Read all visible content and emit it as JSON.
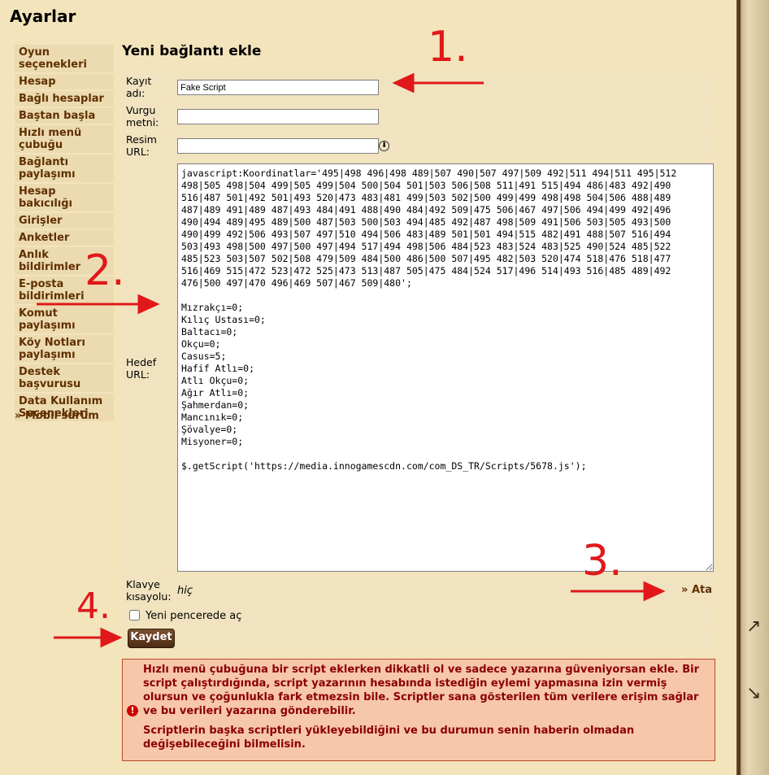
{
  "page_title": "Ayarlar",
  "sidebar": {
    "items": [
      {
        "label": "Oyun seçenekleri"
      },
      {
        "label": "Hesap"
      },
      {
        "label": "Bağlı hesaplar"
      },
      {
        "label": "Baştan başla"
      },
      {
        "label": "Hızlı menü çubuğu"
      },
      {
        "label": "Bağlantı paylaşımı"
      },
      {
        "label": "Hesap bakıcılığı"
      },
      {
        "label": "Girişler"
      },
      {
        "label": "Anketler"
      },
      {
        "label": "Anlık bildirimler"
      },
      {
        "label": "E-posta bildirimleri"
      },
      {
        "label": "Komut paylaşımı"
      },
      {
        "label": "Köy Notları paylaşımı"
      },
      {
        "label": "Destek başvurusu"
      },
      {
        "label": "Data Kullanım Seçenekleri"
      }
    ],
    "mobile_link": "» Mobil sürüm"
  },
  "form": {
    "title": "Yeni bağlantı ekle",
    "name_label": "Kayıt adı:",
    "name_value": "Fake Script",
    "highlight_label": "Vurgu metni:",
    "highlight_value": "",
    "image_label": "Resim URL:",
    "image_value": "",
    "target_label": "Hedef URL:",
    "target_value": "javascript:Koordinatlar='495|498 496|498 489|507 490|507 497|509 492|511 494|511 495|512 498|505 498|504 499|505 499|504 500|504 501|503 506|508 511|491 515|494 486|483 492|490 516|487 501|492 501|493 520|473 483|481 499|503 502|500 499|499 498|498 504|506 488|489 487|489 491|489 487|493 484|491 488|490 484|492 509|475 506|467 497|506 494|499 492|496 490|494 489|495 489|500 487|503 500|503 494|485 492|487 498|509 491|506 503|505 493|500 490|499 492|506 493|507 497|510 494|506 483|489 501|501 494|515 482|491 488|507 516|494 503|493 498|500 497|500 497|494 517|494 498|506 484|523 483|524 483|525 490|524 485|522 485|523 503|507 502|508 479|509 484|500 486|500 507|495 482|503 520|474 518|476 518|477 516|469 515|472 523|472 525|473 513|487 505|475 484|524 517|496 514|493 516|485 489|492 476|500 497|470 496|469 507|467 509|480';\n\nMızrakçı=0;\nKılıç Ustası=0;\nBaltacı=0;\nOkçu=0;\nCasus=5;\nHafif Atlı=0;\nAtlı Okçu=0;\nAğır Atlı=0;\nŞahmerdan=0;\nMancınık=0;\nŞövalye=0;\nMisyoner=0;\n\n$.getScript('https://media.innogamescdn.com/com_DS_TR/Scripts/5678.js');",
    "hotkey_label": "Klavye kısayolu:",
    "hotkey_value": "hiç",
    "assign_link": "» Ata",
    "new_window_label": "Yeni pencerede aç",
    "save_button": "Kaydet"
  },
  "warning": {
    "icon": "exclamation-icon",
    "paragraph1": "Hızlı menü çubuğuna bir script eklerken dikkatli ol ve sadece yazarına güveniyorsan ekle. Bir script çalıştırdığında, script yazarının hesabında istediğin eylemi yapmasına izin vermiş olursun ve çoğunlukla fark etmezsin bile. Scriptler sana gösterilen tüm verilere erişim sağlar ve bu verileri yazarına gönderebilir.",
    "paragraph2": "Scriptlerin başka scriptleri yükleyebildiğini ve bu durumun senin haberin olmadan değişebileceğini bilmelisin."
  },
  "annotations": {
    "step1": "1.",
    "step2": "2.",
    "step3": "3.",
    "step4": "4.",
    "color": "#e0181a"
  },
  "colors": {
    "background": "#f4e4bc",
    "link": "#603000",
    "warning_bg": "#f7c7a9",
    "warning_text": "#8b0000",
    "button": "#603000"
  }
}
